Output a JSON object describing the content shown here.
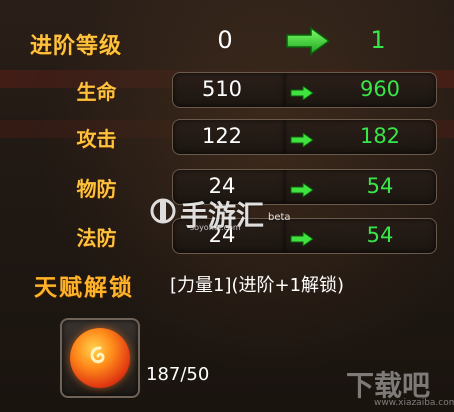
{
  "stats": [
    {
      "label": "进阶等级",
      "before": "0",
      "after": "1"
    },
    {
      "label": "生命",
      "before": "510",
      "after": "960"
    },
    {
      "label": "攻击",
      "before": "122",
      "after": "182"
    },
    {
      "label": "物防",
      "before": "24",
      "after": "54"
    },
    {
      "label": "法防",
      "before": "24",
      "after": "54"
    }
  ],
  "talent": {
    "title": "天赋解锁",
    "description": "[力量1](进阶+1解锁)"
  },
  "item": {
    "icon": "red-orb-icon",
    "count": "187/50"
  },
  "watermarks": {
    "primary": "手游汇",
    "primary_beta": "beta",
    "primary_url": "soyohui.com",
    "secondary": "下载吧",
    "secondary_url": "www.xiazaiba.com"
  },
  "colors": {
    "label": "#ffc23d",
    "after_value": "#38e64a",
    "arrow": "#3fe23f"
  }
}
